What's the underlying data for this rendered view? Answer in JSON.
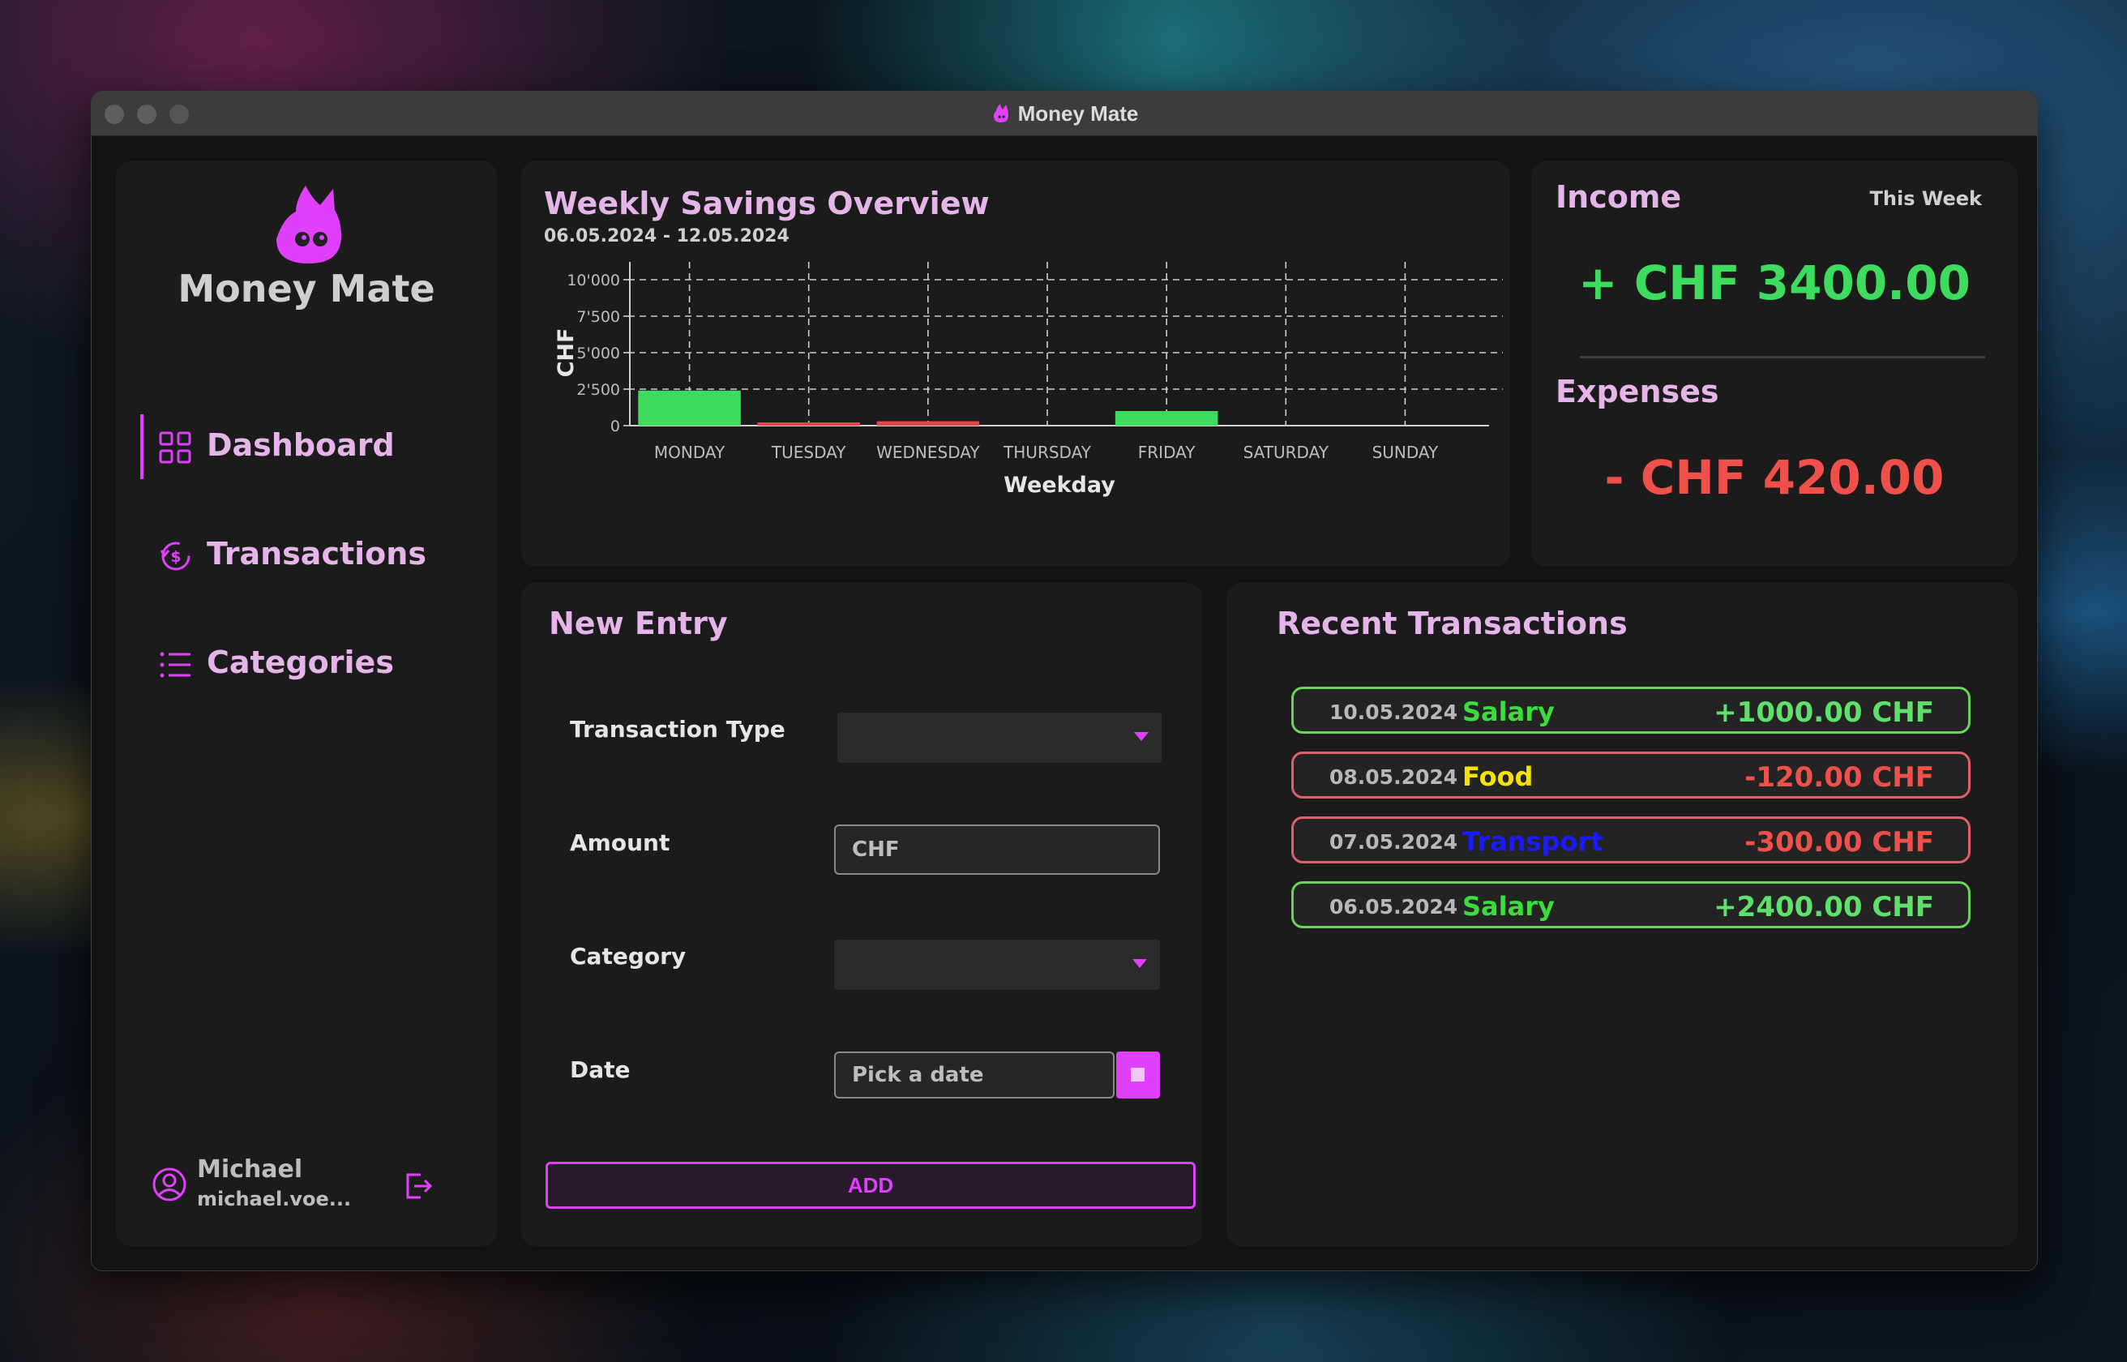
{
  "window": {
    "title": "Money Mate"
  },
  "sidebar": {
    "app_name": "Money Mate",
    "items": [
      {
        "label": "Dashboard",
        "icon": "grid-icon",
        "active": true
      },
      {
        "label": "Transactions",
        "icon": "dollar-cycle-icon",
        "active": false
      },
      {
        "label": "Categories",
        "icon": "list-icon",
        "active": false
      }
    ],
    "user": {
      "name": "Michael",
      "email": "michael.voe..."
    }
  },
  "chart_panel": {
    "title": "Weekly Savings Overview",
    "subtitle": "06.05.2024 - 12.05.2024"
  },
  "chart_data": {
    "type": "bar",
    "categories": [
      "MONDAY",
      "TUESDAY",
      "WEDNESDAY",
      "THURSDAY",
      "FRIDAY",
      "SATURDAY",
      "SUNDAY"
    ],
    "series": [
      {
        "values": [
          2400,
          0,
          0,
          0,
          1000,
          0,
          0
        ],
        "color": "#3ddc5f"
      },
      {
        "values": [
          0,
          -120,
          -300,
          0,
          0,
          0,
          0
        ],
        "color": "#e04848"
      }
    ],
    "xlabel": "Weekday",
    "ylabel": "CHF",
    "yticks": [
      "0",
      "2'500",
      "5'000",
      "7'500",
      "10'000"
    ],
    "ylim": [
      0,
      10000
    ],
    "grid": true
  },
  "summary": {
    "income_label": "Income",
    "period": "This Week",
    "income_value": "+ CHF 3400.00",
    "expenses_label": "Expenses",
    "expenses_value": "- CHF 420.00",
    "colors": {
      "income": "#3ddc5f",
      "expenses": "#f0504a"
    }
  },
  "new_entry": {
    "title": "New Entry",
    "fields": {
      "type_label": "Transaction Type",
      "type_value": "",
      "amount_label": "Amount",
      "amount_placeholder": "CHF",
      "category_label": "Category",
      "category_value": "",
      "date_label": "Date",
      "date_placeholder": "Pick a date"
    },
    "add_label": "ADD"
  },
  "recent": {
    "title": "Recent Transactions",
    "rows": [
      {
        "date": "10.05.2024",
        "category": "Salary",
        "amount": "+1000.00 CHF",
        "category_color": "#3ddc3d",
        "amount_color": "#5ee06a",
        "border": "#6ad35a"
      },
      {
        "date": "08.05.2024",
        "category": "Food",
        "amount": "-120.00 CHF",
        "category_color": "#f5e400",
        "amount_color": "#f0504a",
        "border": "#e0606a"
      },
      {
        "date": "07.05.2024",
        "category": "Transport",
        "amount": "-300.00 CHF",
        "category_color": "#1a1aff",
        "amount_color": "#f0504a",
        "border": "#e0606a"
      },
      {
        "date": "06.05.2024",
        "category": "Salary",
        "amount": "+2400.00 CHF",
        "category_color": "#3ddc3d",
        "amount_color": "#5ee06a",
        "border": "#6ad35a"
      }
    ]
  },
  "colors": {
    "accent": "#e040fb",
    "lavender": "#e5b5ea",
    "bg": "#131313",
    "panel": "#1b1b1b"
  }
}
